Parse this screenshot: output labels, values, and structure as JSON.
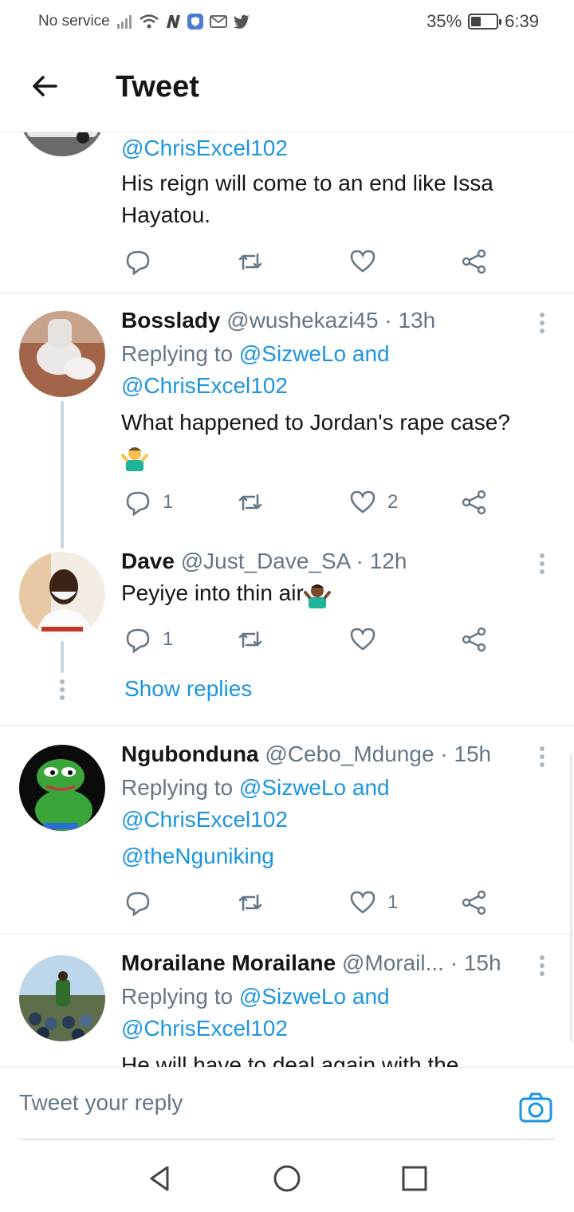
{
  "status_bar": {
    "carrier": "No service",
    "battery": "35%",
    "battery_level": 0.35,
    "time": "6:39",
    "icons": [
      "signal-icon",
      "wifi-icon",
      "n-app-icon",
      "shield-app-icon",
      "gmail-icon",
      "twitter-icon"
    ]
  },
  "header": {
    "title": "Tweet",
    "back_icon": "arrow-left-icon"
  },
  "tweets": [
    {
      "mention_line": "@ChrisExcel102",
      "text_lines": [
        "His reign will come to an end like Issa",
        "Hayatou."
      ],
      "replies": "",
      "likes": ""
    },
    {
      "name": "Bosslady",
      "handle": "@wushekazi45",
      "time": "· 13h",
      "replying_prefix": "Replying to",
      "replying_to": "@SizweLo and",
      "replying_to_2": "@ChrisExcel102",
      "text": "What happened to Jordan's rape case?",
      "emoji": "man-shrugging-emoji",
      "replies": "1",
      "likes": "2"
    },
    {
      "name": "Dave",
      "handle": "@Just_Dave_SA",
      "time": "· 12h",
      "text": "Peyiye into thin air",
      "emoji": "man-shrugging-emoji",
      "replies": "1",
      "likes": ""
    },
    {
      "name": "Ngubonduna",
      "handle": "@Cebo_Mdunge",
      "time": "· 15h",
      "replying_prefix": "Replying to",
      "replying_to": "@SizweLo and",
      "replying_to_2": "@ChrisExcel102",
      "text": "@theNguniking",
      "replies": "",
      "likes": "1"
    },
    {
      "name": "Morailane Morailane",
      "handle": "@Morail...",
      "time": "· 15h",
      "replying_prefix": "Replying to",
      "replying_to": "@SizweLo and",
      "replying_to_2": "@ChrisExcel102",
      "text": "He will have to deal again with the"
    }
  ],
  "show_replies": "Show replies",
  "reply_box": {
    "placeholder": "Tweet your reply",
    "camera_icon": "camera-icon"
  },
  "colors": {
    "link": "#1b95e0",
    "muted": "#657786",
    "divider": "#e6ecf0"
  }
}
